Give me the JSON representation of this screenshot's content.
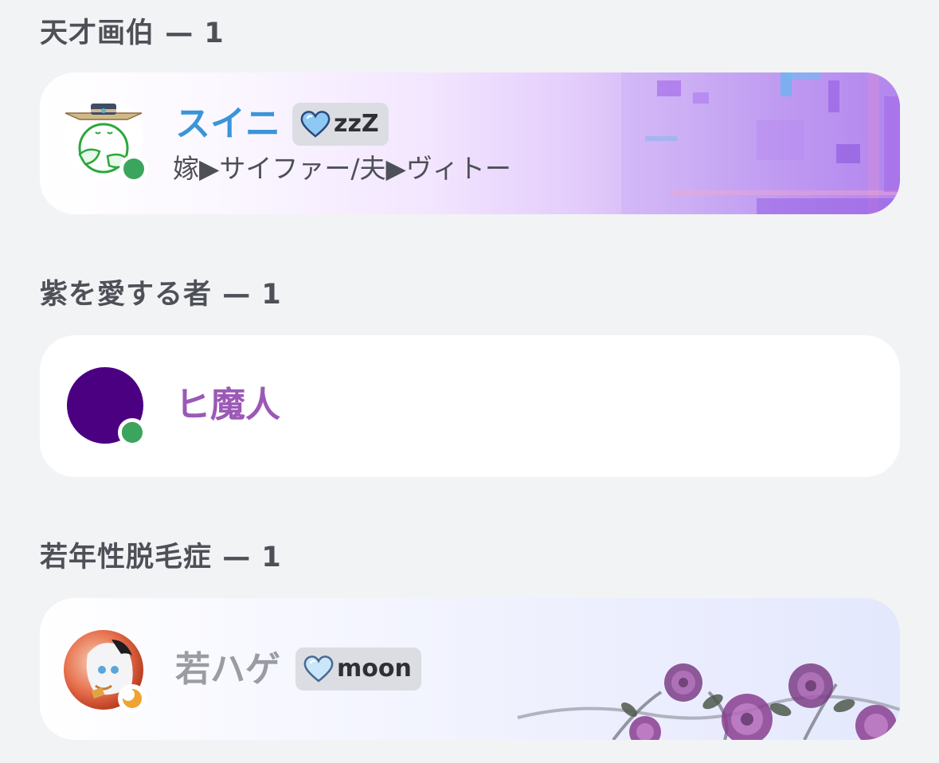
{
  "sections": [
    {
      "role": "天才画伯",
      "separator": "—",
      "count": "1",
      "member": {
        "name": "スイニ",
        "name_color": "#3a95d8",
        "status_text": "zzZ",
        "status_icon": "blue-heart-icon",
        "bio": "嫁▶サイファー/夫▶ヴィトー",
        "online": "online",
        "status_dot_color": "#3ba55d"
      }
    },
    {
      "role": "紫を愛する者",
      "separator": "—",
      "count": "1",
      "member": {
        "name": "ヒ魔人",
        "name_color": "#9b59b6",
        "avatar_color": "#4b0082",
        "online": "online",
        "status_dot_color": "#3ba55d"
      }
    },
    {
      "role": "若年性脱毛症",
      "separator": "—",
      "count": "1",
      "member": {
        "name": "若ハゲ",
        "name_color": "#9a9ca4",
        "status_text": "moon",
        "status_icon": "light-blue-heart-icon",
        "online": "idle",
        "status_dot_color": "#f0a232"
      }
    }
  ]
}
